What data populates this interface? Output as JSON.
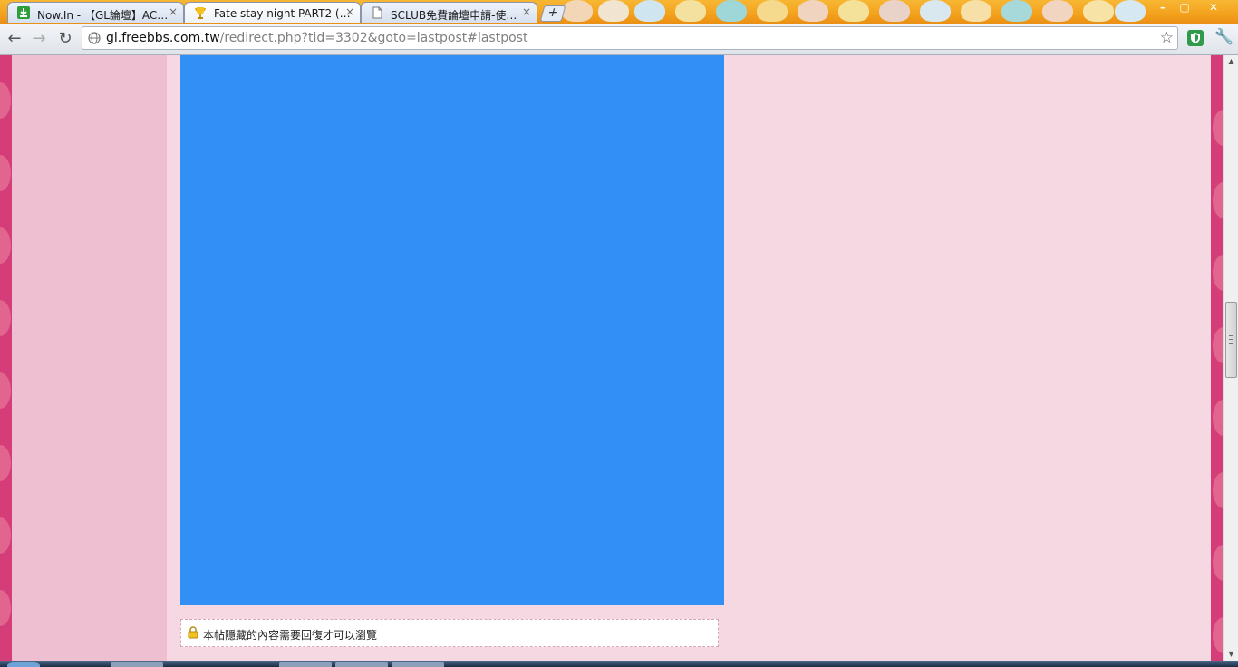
{
  "browser": {
    "tabs": [
      {
        "title": "Now.In - 【GL論壇】AC…",
        "favicon": "green-download-icon",
        "active": false
      },
      {
        "title": "Fate stay night PART2 (…",
        "favicon": "trophy-icon",
        "active": true
      },
      {
        "title": "SCLUB免費論壇申請-使…",
        "favicon": "document-icon",
        "active": false
      }
    ],
    "new_tab_label": "+",
    "window_controls": {
      "minimize": "–",
      "maximize": "▢",
      "close": "✕"
    },
    "toolbar": {
      "back_icon": "←",
      "forward_icon": "→",
      "reload_icon": "↻",
      "url_host": "gl.freebbs.com.tw",
      "url_path": "/redirect.php?tid=3302&goto=lastpost#lastpost",
      "star_icon": "☆",
      "wrench_icon": "🔧"
    }
  },
  "page": {
    "locked_notice": "本帖隱藏的內容需要回復才可以瀏覽",
    "image_color": "#318ff5",
    "background_color": "#f6d8e3",
    "accent_color": "#d43d78"
  },
  "scrollbar": {
    "up_arrow": "▲",
    "down_arrow": "▼"
  }
}
